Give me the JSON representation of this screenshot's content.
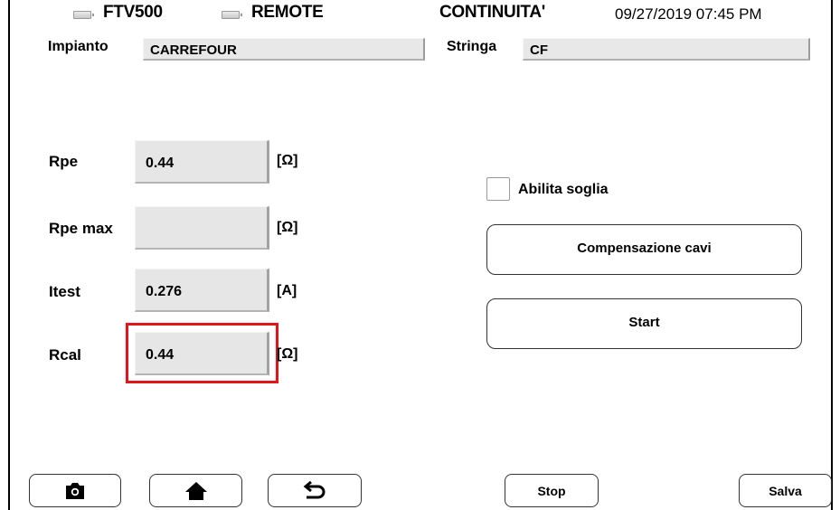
{
  "status_bar": {
    "device": "FTV500",
    "mode": "REMOTE",
    "test": "CONTINUITA'",
    "datetime": "09/27/2019 07:45 PM"
  },
  "header": {
    "impianto_label": "Impianto",
    "impianto_value": "CARREFOUR",
    "stringa_label": "Stringa",
    "stringa_value": "CF"
  },
  "measurements": [
    {
      "label": "Rpe",
      "value": "0.44",
      "unit": "[Ω]"
    },
    {
      "label": "Rpe max",
      "value": "",
      "unit": "[Ω]"
    },
    {
      "label": "Itest",
      "value": "0.276",
      "unit": "[A]"
    },
    {
      "label": "Rcal",
      "value": "0.44",
      "unit": "[Ω]"
    }
  ],
  "controls": {
    "abilita_soglia_label": "Abilita soglia",
    "abilita_soglia_checked": false,
    "compensazione_label": "Compensazione cavi",
    "start_label": "Start"
  },
  "bottom_bar": {
    "camera_icon": "camera-icon",
    "home_icon": "home-icon",
    "back_icon": "back-arrow-icon",
    "stop_label": "Stop",
    "salva_label": "Salva"
  },
  "highlight_color": "#e3141b"
}
